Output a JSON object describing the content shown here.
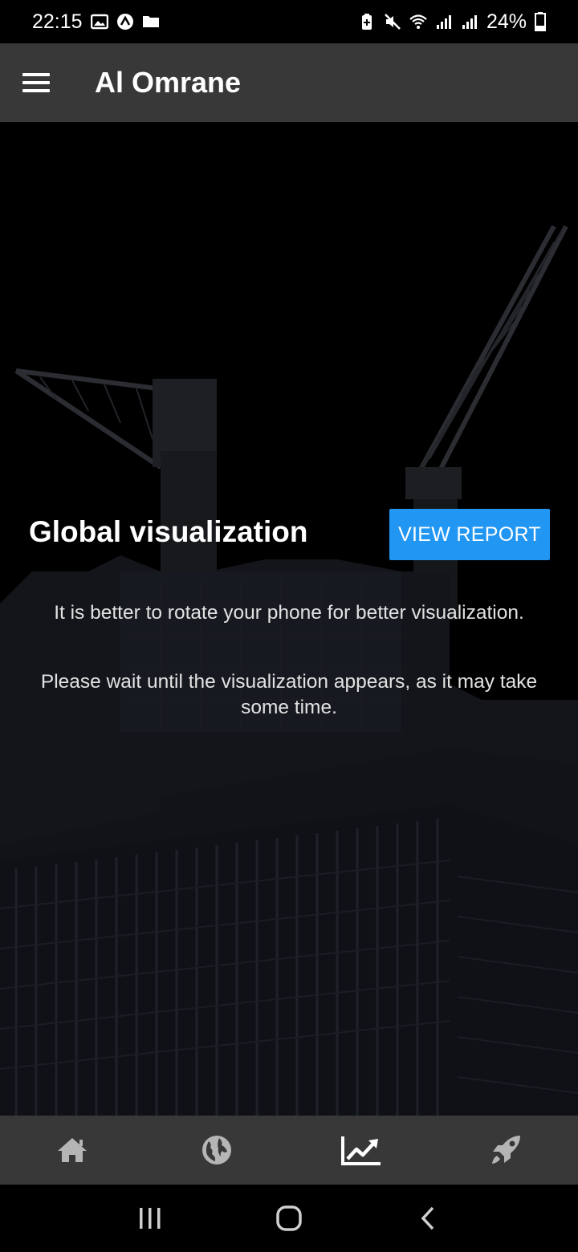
{
  "status_bar": {
    "time": "22:15",
    "battery": "24%",
    "left_icons": [
      "gallery-icon",
      "app-notification-icon",
      "folder-icon"
    ],
    "right_icons": [
      "battery-saver-icon",
      "mute-icon",
      "wifi-icon",
      "signal-icon",
      "signal-icon",
      "battery-icon"
    ]
  },
  "app_bar": {
    "title": "Al Omrane"
  },
  "main": {
    "title": "Global visualization",
    "view_report_label": "VIEW REPORT",
    "hint_rotate": "It is better to rotate your phone for better visualization.",
    "hint_wait": "Please wait until the visualization appears, as it may take some time."
  },
  "bottom_nav": {
    "items": [
      {
        "icon": "home-icon"
      },
      {
        "icon": "globe-icon"
      },
      {
        "icon": "chart-line-icon",
        "active": true
      },
      {
        "icon": "rocket-icon"
      }
    ],
    "active_color": "#ffffff",
    "inactive_color": "#b5b5b5"
  },
  "colors": {
    "app_bar_bg": "#383838",
    "button_bg": "#2196f3",
    "background": "#000000"
  }
}
